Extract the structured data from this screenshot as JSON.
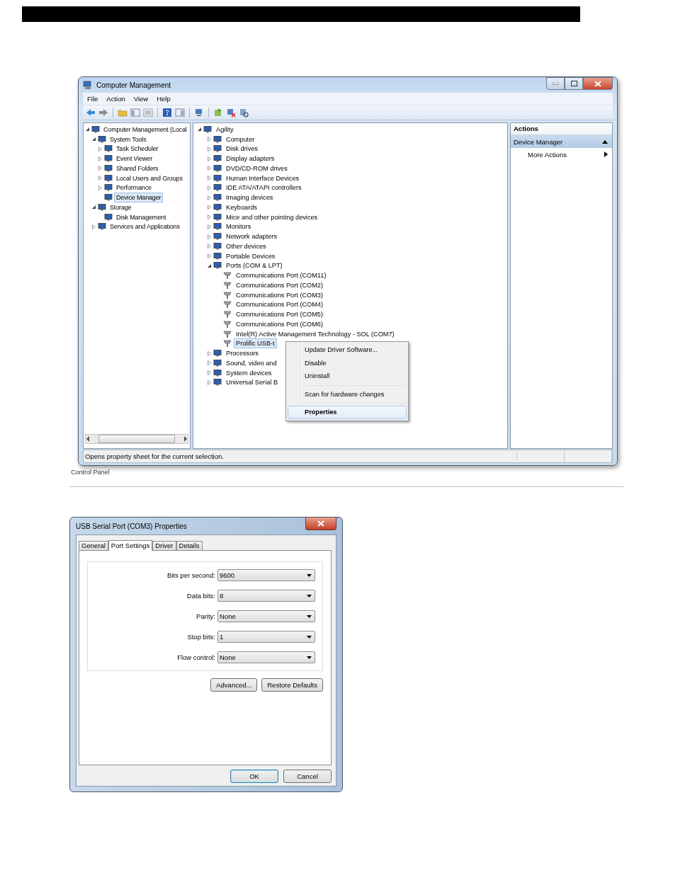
{
  "computer_management": {
    "title": "Computer Management",
    "menu": [
      "File",
      "Action",
      "View",
      "Help"
    ],
    "left_tree": [
      {
        "label": "Computer Management (Local",
        "expanded": true,
        "selected": false,
        "children": [
          {
            "label": "System Tools",
            "expanded": true,
            "selected": false,
            "children": [
              {
                "label": "Task Scheduler",
                "expanded": false,
                "selected": false
              },
              {
                "label": "Event Viewer",
                "expanded": false,
                "selected": false
              },
              {
                "label": "Shared Folders",
                "expanded": false,
                "selected": false
              },
              {
                "label": "Local Users and Groups",
                "expanded": false,
                "selected": false
              },
              {
                "label": "Performance",
                "expanded": false,
                "selected": false
              },
              {
                "label": "Device Manager",
                "selected": true
              }
            ]
          },
          {
            "label": "Storage",
            "expanded": true,
            "selected": false,
            "children": [
              {
                "label": "Disk Management",
                "selected": false
              }
            ]
          },
          {
            "label": "Services and Applications",
            "expanded": false,
            "selected": false
          }
        ]
      }
    ],
    "device_tree": [
      {
        "label": "Agility",
        "expanded": true,
        "selected": false,
        "children": [
          {
            "label": "Computer",
            "expanded": false,
            "selected": false
          },
          {
            "label": "Disk drives",
            "expanded": false,
            "selected": false
          },
          {
            "label": "Display adapters",
            "expanded": false,
            "selected": false
          },
          {
            "label": "DVD/CD-ROM drives",
            "expanded": false,
            "selected": false
          },
          {
            "label": "Human Interface Devices",
            "expanded": false,
            "selected": false
          },
          {
            "label": "IDE ATA/ATAPI controllers",
            "expanded": false,
            "selected": false
          },
          {
            "label": "Imaging devices",
            "expanded": false,
            "selected": false
          },
          {
            "label": "Keyboards",
            "expanded": false,
            "selected": false
          },
          {
            "label": "Mice and other pointing devices",
            "expanded": false,
            "selected": false
          },
          {
            "label": "Monitors",
            "expanded": false,
            "selected": false
          },
          {
            "label": "Network adapters",
            "expanded": false,
            "selected": false
          },
          {
            "label": "Other devices",
            "expanded": false,
            "selected": false
          },
          {
            "label": "Portable Devices",
            "expanded": false,
            "selected": false
          },
          {
            "label": "Ports (COM & LPT)",
            "expanded": true,
            "selected": false,
            "children": [
              {
                "label": "Communications Port (COM11)",
                "selected": false
              },
              {
                "label": "Communications Port (COM2)",
                "selected": false
              },
              {
                "label": "Communications Port (COM3)",
                "selected": false
              },
              {
                "label": "Communications Port (COM4)",
                "selected": false
              },
              {
                "label": "Communications Port (COM5)",
                "selected": false
              },
              {
                "label": "Communications Port (COM6)",
                "selected": false
              },
              {
                "label": "Intel(R) Active Management Technology - SOL (COM7)",
                "selected": false
              },
              {
                "label": "Prolific USB-t",
                "selected": true
              }
            ]
          },
          {
            "label": "Processors",
            "expanded": false,
            "selected": false
          },
          {
            "label": "Sound, video and",
            "expanded": false,
            "selected": false
          },
          {
            "label": "System devices",
            "expanded": false,
            "selected": false
          },
          {
            "label": "Universal Serial B",
            "expanded": false,
            "selected": false
          }
        ]
      }
    ],
    "context_menu": [
      {
        "kind": "item",
        "label": "Update Driver Software...",
        "selected": false,
        "default": false
      },
      {
        "kind": "item",
        "label": "Disable",
        "selected": false,
        "default": false
      },
      {
        "kind": "item",
        "label": "Uninstall",
        "selected": false,
        "default": false
      },
      {
        "kind": "separator"
      },
      {
        "kind": "item",
        "label": "Scan for hardware changes",
        "selected": false,
        "default": false
      },
      {
        "kind": "separator"
      },
      {
        "kind": "item",
        "label": "Properties",
        "selected": true,
        "default": true
      }
    ],
    "actions": {
      "header": "Actions",
      "section": "Device Manager",
      "items": [
        "More Actions"
      ]
    },
    "status_bar": "Opens property sheet for the current selection."
  },
  "background_text": "Control Panel",
  "properties_dialog": {
    "title": "USB Serial Port (COM3) Properties",
    "tabs": [
      {
        "label": "General",
        "selected": false
      },
      {
        "label": "Port Settings",
        "selected": true
      },
      {
        "label": "Driver",
        "selected": false
      },
      {
        "label": "Details",
        "selected": false
      }
    ],
    "fields": [
      {
        "label": "Bits per second:",
        "value": "9600"
      },
      {
        "label": "Data bits:",
        "value": "8"
      },
      {
        "label": "Parity:",
        "value": "None"
      },
      {
        "label": "Stop bits:",
        "value": "1"
      },
      {
        "label": "Flow control:",
        "value": "None"
      }
    ],
    "buttons": [
      "Advanced...",
      "Restore Defaults"
    ],
    "footer_buttons": [
      {
        "label": "OK",
        "default": true
      },
      {
        "label": "Cancel",
        "default": false
      }
    ]
  }
}
